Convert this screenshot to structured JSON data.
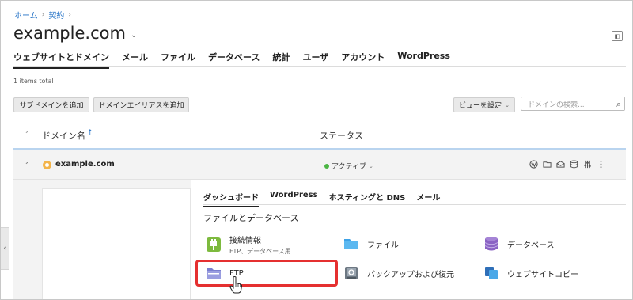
{
  "breadcrumb": {
    "items": [
      "ホーム",
      "契約"
    ]
  },
  "page": {
    "title": "example.com"
  },
  "tabs": [
    "ウェブサイトとドメイン",
    "メール",
    "ファイル",
    "データベース",
    "統計",
    "ユーザ",
    "アカウント",
    "WordPress"
  ],
  "list": {
    "count": "1 items total"
  },
  "toolbar": {
    "add_subdomain": "サブドメインを追加",
    "add_alias": "ドメインエイリアスを追加",
    "view_settings": "ビューを設定",
    "search_placeholder": "ドメインの検索..."
  },
  "table": {
    "col_domain": "ドメイン名",
    "col_status": "ステータス",
    "row": {
      "domain": "example.com",
      "status": "アクティブ"
    }
  },
  "detail": {
    "tabs": [
      "ダッシュボード",
      "WordPress",
      "ホスティングと DNS",
      "メール"
    ],
    "section_title": "ファイルとデータベース",
    "tiles": {
      "connection": {
        "label": "接続情報",
        "sub": "FTP、データベース用"
      },
      "file_manager": {
        "label": "ファイル"
      },
      "database": {
        "label": "データベース"
      },
      "ftp": {
        "label": "FTP"
      },
      "backup": {
        "label": "バックアップおよび復元"
      },
      "site_copy": {
        "label": "ウェブサイトコピー"
      }
    }
  },
  "colors": {
    "link": "#1f6fc5",
    "active_status": "#4bb543",
    "highlight": "#e53030",
    "connection_icon": "#7dba3e",
    "file_icon": "#3ea2e6",
    "database_icon": "#8a63c4"
  }
}
